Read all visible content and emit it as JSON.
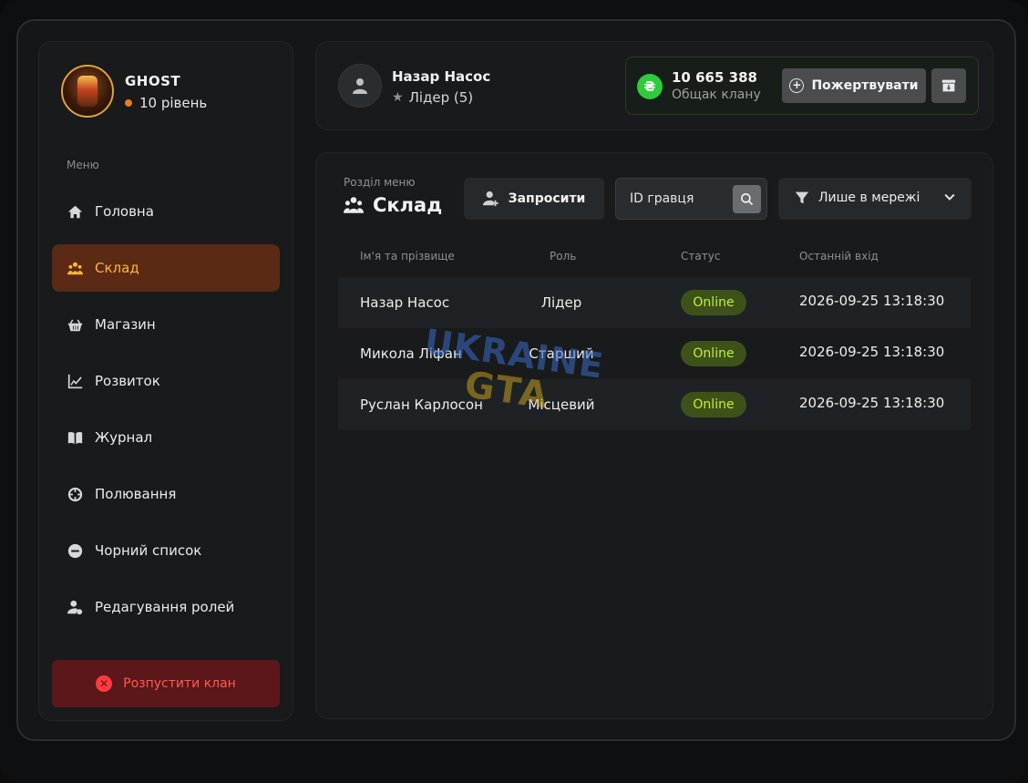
{
  "clan": {
    "name": "GHOST",
    "level": "10 рівень"
  },
  "sidebar": {
    "menu_caption": "Меню",
    "items": [
      {
        "label": "Головна",
        "icon": "home-icon"
      },
      {
        "label": "Склад",
        "icon": "users-icon",
        "active": true
      },
      {
        "label": "Магазин",
        "icon": "basket-icon"
      },
      {
        "label": "Розвиток",
        "icon": "chart-line-icon"
      },
      {
        "label": "Журнал",
        "icon": "book-icon"
      },
      {
        "label": "Полювання",
        "icon": "crosshair-icon"
      },
      {
        "label": "Чорний список",
        "icon": "minus-circle-icon"
      },
      {
        "label": "Редагування ролей",
        "icon": "user-gear-icon"
      }
    ],
    "disband_label": "Розпустити клан"
  },
  "header": {
    "user_name": "Назар Насос",
    "user_role": "Лідер (5)",
    "bank_amount": "10 665 388",
    "bank_label": "Общак клану",
    "currency_symbol": "₴",
    "donate_label": "Пожертвувати"
  },
  "content": {
    "section_caption": "Розділ меню",
    "section_title": "Склад",
    "invite_label": "Запросити",
    "search_placeholder": "ID гравця",
    "filter_label": "Лише в мережі",
    "columns": {
      "name": "Ім'я та прізвище",
      "role": "Роль",
      "status": "Статус",
      "last_login": "Останній вхід"
    },
    "rows": [
      {
        "name": "Назар Насос",
        "role": "Лідер",
        "status": "Online",
        "last_login": "2026-09-25 13:18:30"
      },
      {
        "name": "Микола Ліфан",
        "role": "Старший",
        "status": "Online",
        "last_login": "2026-09-25 13:18:30"
      },
      {
        "name": "Руслан Карлосон",
        "role": "Місцевий",
        "status": "Online",
        "last_login": "2026-09-25 13:18:30"
      }
    ]
  },
  "watermark": {
    "line1": "UKRAINE",
    "line2": "GTA"
  },
  "colors": {
    "accent": "#ffb43a",
    "active_bg": "#5a2a14",
    "danger": "#ff5a55",
    "online": "#c5ee3a",
    "money": "#2ecb3d"
  }
}
